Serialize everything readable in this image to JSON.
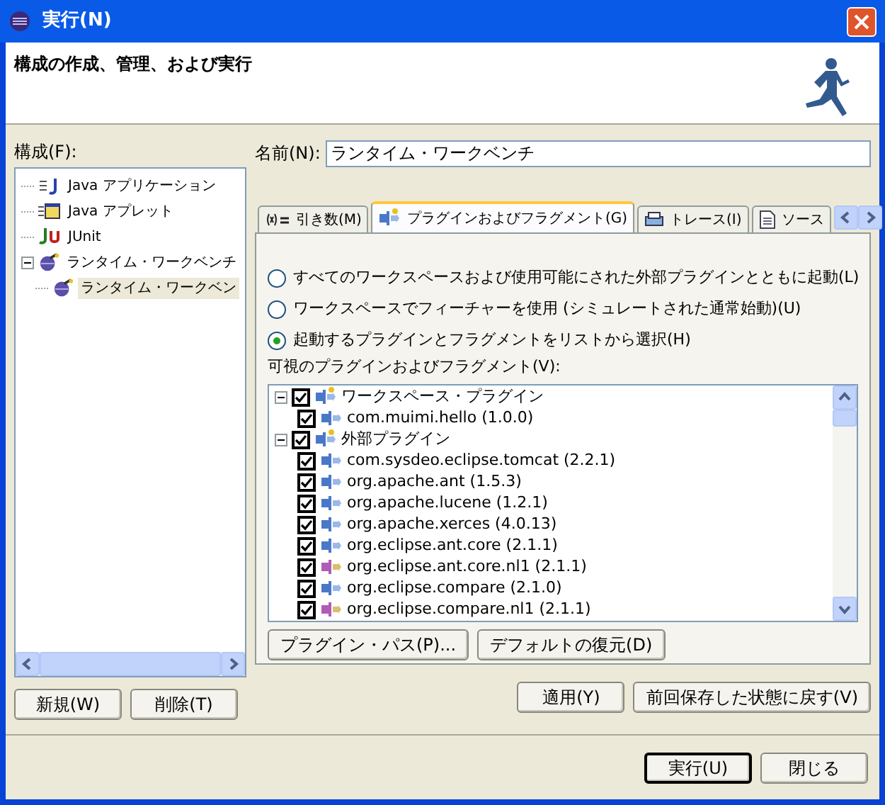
{
  "window": {
    "title": "実行(N)"
  },
  "header": {
    "title": "構成の作成、管理、および実行"
  },
  "sidebar": {
    "label": "構成(F):",
    "items": [
      {
        "label": "Java アプリケーション",
        "kind": "java-app",
        "selected": false
      },
      {
        "label": "Java アプレット",
        "kind": "applet",
        "selected": false
      },
      {
        "label": "JUnit",
        "kind": "junit",
        "selected": false
      },
      {
        "label": "ランタイム・ワークベンチ",
        "kind": "workbench",
        "selected": false,
        "expanded": true,
        "children": [
          {
            "label": "ランタイム・ワークベン",
            "kind": "workbench",
            "selected": true
          }
        ]
      }
    ],
    "buttons": [
      "新規(W)",
      "削除(T)"
    ]
  },
  "name_field": {
    "label": "名前(N):",
    "value": "ランタイム・ワークベンチ"
  },
  "tabs": [
    {
      "label": "引き数(M)",
      "kind": "variables",
      "selected": false
    },
    {
      "label": "プラグインおよびフラグメント(G)",
      "kind": "plugins",
      "selected": true
    },
    {
      "label": "トレース(I)",
      "kind": "trace",
      "selected": false
    },
    {
      "label": "ソース",
      "kind": "source",
      "selected": false
    }
  ],
  "launch_options": [
    {
      "label": "すべてのワークスペースおよび使用可能にされた外部プラグインとともに起動(L)",
      "selected": false
    },
    {
      "label": "ワークスペースでフィーチャーを使用 (シミュレートされた通常始動)(U)",
      "selected": false
    },
    {
      "label": "起動するプラグインとフラグメントをリストから選択(H)",
      "selected": true
    }
  ],
  "plugins": {
    "label": "可視のプラグインおよびフラグメント(V):",
    "groups": [
      {
        "label": "ワークスペース・プラグイン",
        "checked": true,
        "expanded": true,
        "children": [
          {
            "label": "com.muimi.hello (1.0.0)",
            "kind": "plugin",
            "checked": true
          }
        ]
      },
      {
        "label": "外部プラグイン",
        "checked": true,
        "expanded": true,
        "children": [
          {
            "label": "com.sysdeo.eclipse.tomcat (2.2.1)",
            "kind": "plugin",
            "checked": true
          },
          {
            "label": "org.apache.ant (1.5.3)",
            "kind": "plugin",
            "checked": true
          },
          {
            "label": "org.apache.lucene (1.2.1)",
            "kind": "plugin",
            "checked": true
          },
          {
            "label": "org.apache.xerces (4.0.13)",
            "kind": "plugin",
            "checked": true
          },
          {
            "label": "org.eclipse.ant.core (2.1.1)",
            "kind": "plugin",
            "checked": true
          },
          {
            "label": "org.eclipse.ant.core.nl1 (2.1.1)",
            "kind": "fragment",
            "checked": true
          },
          {
            "label": "org.eclipse.compare (2.1.0)",
            "kind": "plugin",
            "checked": true
          },
          {
            "label": "org.eclipse.compare.nl1 (2.1.1)",
            "kind": "fragment",
            "checked": true
          }
        ]
      }
    ],
    "buttons": [
      "プラグイン・パス(P)...",
      "デフォルトの復元(D)"
    ]
  },
  "form_buttons": [
    "適用(Y)",
    "前回保存した状態に戻す(V)"
  ],
  "dialog_buttons": [
    {
      "label": "実行(U)",
      "default": true
    },
    {
      "label": "閉じる",
      "default": false
    }
  ]
}
